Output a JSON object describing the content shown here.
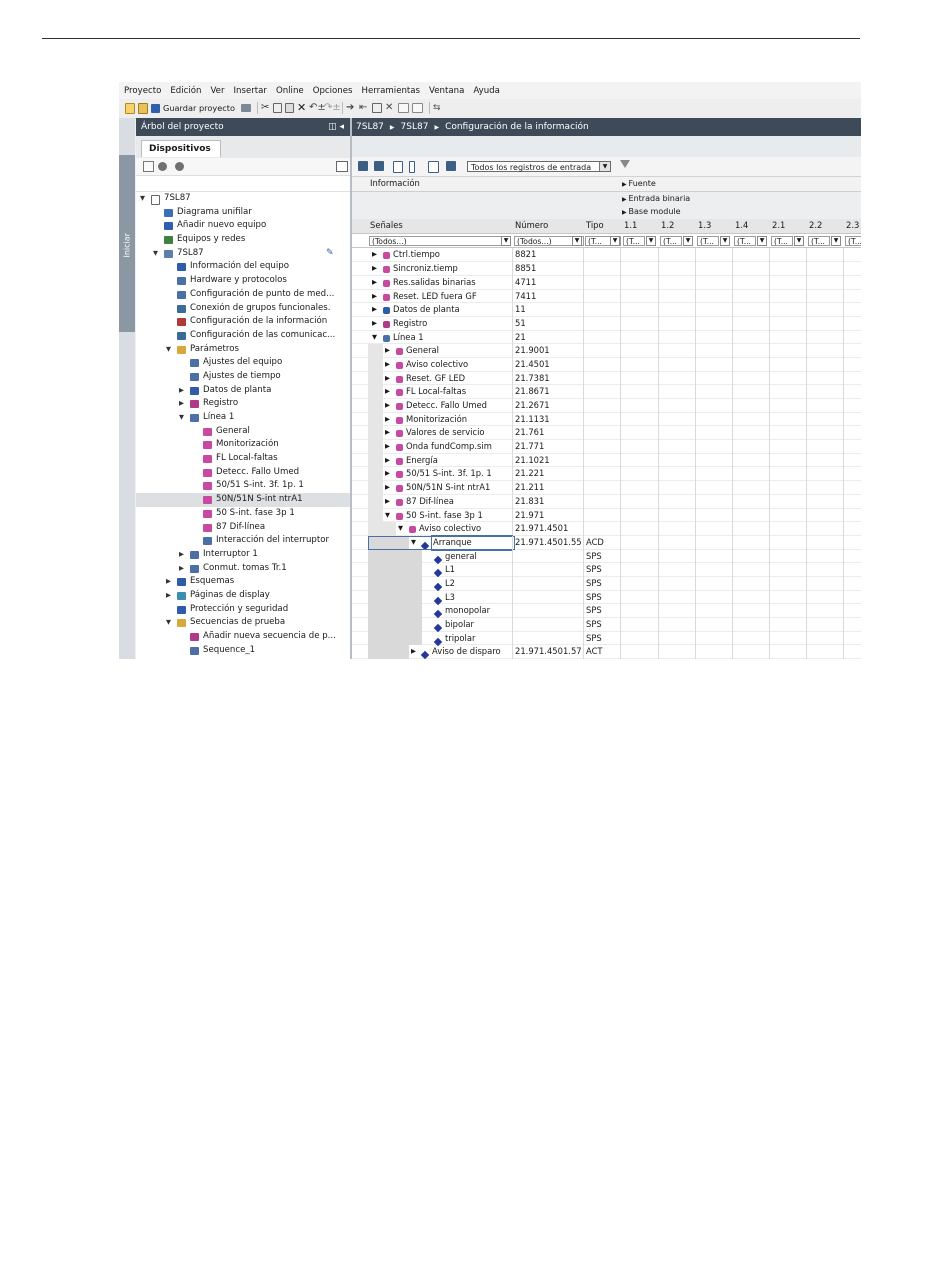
{
  "menu": [
    "Proyecto",
    "Edición",
    "Ver",
    "Insertar",
    "Online",
    "Opciones",
    "Herramientas",
    "Ventana",
    "Ayuda"
  ],
  "toolbar": {
    "save_label": "Guardar proyecto"
  },
  "side_tab": "Iniciar",
  "project_tree": {
    "title": "Árbol del proyecto",
    "tab": "Dispositivos",
    "items": [
      {
        "label": "7SL87",
        "level": 0,
        "expand": "open",
        "icon": "device-icon",
        "color": "#ffffff"
      },
      {
        "label": "Diagrama unifilar",
        "level": 1,
        "expand": "",
        "icon": "single-line-icon",
        "color": "#3b6fb6"
      },
      {
        "label": "Añadir nuevo equipo",
        "level": 1,
        "expand": "",
        "icon": "add-device-icon",
        "color": "#2f5fb0"
      },
      {
        "label": "Equipos y redes",
        "level": 1,
        "expand": "",
        "icon": "network-icon",
        "color": "#3f7f3f"
      },
      {
        "label": "7SL87",
        "level": 1,
        "expand": "open",
        "icon": "device-icon",
        "color": "#5a7fa8"
      },
      {
        "label": "Información del equipo",
        "level": 2,
        "expand": "",
        "icon": "info-icon",
        "color": "#2e5ca8"
      },
      {
        "label": "Hardware y protocolos",
        "level": 2,
        "expand": "",
        "icon": "hardware-icon",
        "color": "#4b6fa6"
      },
      {
        "label": "Configuración de punto de med...",
        "level": 2,
        "expand": "",
        "icon": "config-icon",
        "color": "#4b6fa6"
      },
      {
        "label": "Conexión de grupos funcionales.",
        "level": 2,
        "expand": "",
        "icon": "connect-icon",
        "color": "#3a6c98"
      },
      {
        "label": "Configuración de la información",
        "level": 2,
        "expand": "",
        "icon": "matrix-icon",
        "color": "#b03a3a"
      },
      {
        "label": "Configuración de las comunicac...",
        "level": 2,
        "expand": "",
        "icon": "comm-icon",
        "color": "#3a6c98"
      },
      {
        "label": "Parámetros",
        "level": 2,
        "expand": "open",
        "icon": "params-icon",
        "color": "#d7a93c"
      },
      {
        "label": "Ajustes del equipo",
        "level": 3,
        "expand": "",
        "icon": "settings-icon",
        "color": "#4b6fa6"
      },
      {
        "label": "Ajustes de tiempo",
        "level": 3,
        "expand": "",
        "icon": "clock-icon",
        "color": "#4b6fa6"
      },
      {
        "label": "Datos de planta",
        "level": 3,
        "expand": "closed",
        "icon": "plant-icon",
        "color": "#2e5ca8"
      },
      {
        "label": "Registro",
        "level": 3,
        "expand": "closed",
        "icon": "recorder-icon",
        "color": "#b03a8a"
      },
      {
        "label": "Línea 1",
        "level": 3,
        "expand": "open",
        "icon": "line-icon",
        "color": "#4b6fa6"
      },
      {
        "label": "General",
        "level": 4,
        "expand": "",
        "icon": "function-block-icon",
        "color": "#c84aa0"
      },
      {
        "label": "Monitorización",
        "level": 4,
        "expand": "",
        "icon": "function-block-icon",
        "color": "#c84aa0"
      },
      {
        "label": "FL Local-faltas",
        "level": 4,
        "expand": "",
        "icon": "function-block-icon",
        "color": "#c84aa0"
      },
      {
        "label": "Detecc. Fallo Umed",
        "level": 4,
        "expand": "",
        "icon": "function-block-icon",
        "color": "#c84aa0"
      },
      {
        "label": "50/51 S-int. 3f. 1p. 1",
        "level": 4,
        "expand": "",
        "icon": "function-block-icon",
        "color": "#c84aa0"
      },
      {
        "label": "50N/51N S-int ntrA1",
        "level": 4,
        "expand": "",
        "icon": "function-block-icon",
        "color": "#c84aa0",
        "selected": true
      },
      {
        "label": "50 S-int. fase 3p 1",
        "level": 4,
        "expand": "",
        "icon": "function-block-icon",
        "color": "#c84aa0"
      },
      {
        "label": "87 Dif-línea",
        "level": 4,
        "expand": "",
        "icon": "function-block-icon",
        "color": "#c84aa0"
      },
      {
        "label": "Interacción del interruptor",
        "level": 4,
        "expand": "",
        "icon": "interaction-icon",
        "color": "#4b6fa6"
      },
      {
        "label": "Interruptor 1",
        "level": 3,
        "expand": "closed",
        "icon": "breaker-icon",
        "color": "#4b6fa6"
      },
      {
        "label": "Conmut. tomas Tr.1",
        "level": 3,
        "expand": "closed",
        "icon": "tapchanger-icon",
        "color": "#4b6fa6"
      },
      {
        "label": "Esquemas",
        "level": 2,
        "expand": "closed",
        "icon": "chart-icon",
        "color": "#2e5ca8"
      },
      {
        "label": "Páginas de display",
        "level": 2,
        "expand": "closed",
        "icon": "display-icon",
        "color": "#3a8fb0"
      },
      {
        "label": "Protección y seguridad",
        "level": 2,
        "expand": "",
        "icon": "security-icon",
        "color": "#2e5ca8"
      },
      {
        "label": "Secuencias de prueba",
        "level": 2,
        "expand": "open",
        "icon": "test-seq-icon",
        "color": "#d7a93c"
      },
      {
        "label": "Añadir nueva secuencia de p...",
        "level": 3,
        "expand": "",
        "icon": "add-seq-icon",
        "color": "#b03a8a"
      },
      {
        "label": "Sequence_1",
        "level": 3,
        "expand": "",
        "icon": "sequence-icon",
        "color": "#4b6fa6"
      }
    ]
  },
  "editor": {
    "breadcrumb": [
      "7SL87",
      "7SL87",
      "Configuración de la información"
    ],
    "filter_select": "Todos los registros de entrada",
    "info_header": "Información",
    "source_header": "Fuente",
    "binary_input_header": "Entrada binaria",
    "base_module_header": "Base module",
    "columns": {
      "signals": "Señales",
      "number": "Número",
      "type": "Tipo"
    },
    "module_columns": [
      "1.1",
      "1.2",
      "1.3",
      "1.4",
      "2.1",
      "2.2",
      "2.3"
    ],
    "filters": {
      "signals": "(Todos...)",
      "number": "(Todos...)",
      "type": "(T...",
      "module": "(T..."
    },
    "rows": [
      {
        "label": "Ctrl.tiempo",
        "number": "8821",
        "type": "",
        "level": 0,
        "expand": "closed",
        "icon": "function-block-icon",
        "marks": {}
      },
      {
        "label": "Sincroniz.tiemp",
        "number": "8851",
        "type": "",
        "level": 0,
        "expand": "closed",
        "icon": "function-block-icon",
        "marks": {}
      },
      {
        "label": "Res.salidas binarias",
        "number": "4711",
        "type": "",
        "level": 0,
        "expand": "closed",
        "icon": "function-block-icon",
        "marks": {}
      },
      {
        "label": "Reset. LED fuera GF",
        "number": "7411",
        "type": "",
        "level": 0,
        "expand": "closed",
        "icon": "function-block-icon",
        "marks": {}
      },
      {
        "label": "Datos de planta",
        "number": "11",
        "type": "",
        "level": 0,
        "expand": "closed",
        "icon": "plant-icon",
        "marks": {
          "2.2": "*"
        }
      },
      {
        "label": "Registro",
        "number": "51",
        "type": "",
        "level": 0,
        "expand": "closed",
        "icon": "recorder-icon",
        "marks": {}
      },
      {
        "label": "Línea 1",
        "number": "21",
        "type": "",
        "level": 0,
        "expand": "open",
        "icon": "line-icon",
        "marks": {}
      },
      {
        "label": "General",
        "number": "21.9001",
        "type": "",
        "level": 1,
        "expand": "closed",
        "icon": "function-block-icon",
        "marks": {}
      },
      {
        "label": "Aviso colectivo",
        "number": "21.4501",
        "type": "",
        "level": 1,
        "expand": "closed",
        "icon": "function-block-icon",
        "marks": {}
      },
      {
        "label": "Reset. GF LED",
        "number": "21.7381",
        "type": "",
        "level": 1,
        "expand": "closed",
        "icon": "function-block-icon",
        "marks": {}
      },
      {
        "label": "FL Local-faltas",
        "number": "21.8671",
        "type": "",
        "level": 1,
        "expand": "closed",
        "icon": "function-block-icon",
        "marks": {}
      },
      {
        "label": "Detecc. Fallo Umed",
        "number": "21.2671",
        "type": "",
        "level": 1,
        "expand": "closed",
        "icon": "function-block-icon",
        "marks": {}
      },
      {
        "label": "Monitorización",
        "number": "21.1131",
        "type": "",
        "level": 1,
        "expand": "closed",
        "icon": "function-block-icon",
        "marks": {}
      },
      {
        "label": "Valores de servicio",
        "number": "21.761",
        "type": "",
        "level": 1,
        "expand": "closed",
        "icon": "function-block-icon",
        "marks": {}
      },
      {
        "label": "Onda fundComp.sim",
        "number": "21.771",
        "type": "",
        "level": 1,
        "expand": "closed",
        "icon": "function-block-icon",
        "marks": {}
      },
      {
        "label": "Energía",
        "number": "21.1021",
        "type": "",
        "level": 1,
        "expand": "closed",
        "icon": "function-block-icon",
        "marks": {}
      },
      {
        "label": "50/51 S-int. 3f. 1p. 1",
        "number": "21.221",
        "type": "",
        "level": 1,
        "expand": "closed",
        "icon": "function-block-icon",
        "marks": {}
      },
      {
        "label": "50N/51N S-int ntrA1",
        "number": "21.211",
        "type": "",
        "level": 1,
        "expand": "closed",
        "icon": "function-block-icon",
        "marks": {}
      },
      {
        "label": "87 Dif-línea",
        "number": "21.831",
        "type": "",
        "level": 1,
        "expand": "closed",
        "icon": "function-block-icon",
        "marks": {}
      },
      {
        "label": "50 S-int. fase 3p 1",
        "number": "21.971",
        "type": "",
        "level": 1,
        "expand": "open",
        "icon": "function-block-icon",
        "marks": {}
      },
      {
        "label": "Aviso colectivo",
        "number": "21.971.4501",
        "type": "",
        "level": 2,
        "expand": "open",
        "icon": "function-block-icon",
        "marks": {}
      },
      {
        "label": "Arranque",
        "number": "21.971.4501.55",
        "type": "ACD",
        "level": 3,
        "expand": "open",
        "icon": "signal-icon",
        "marks": {},
        "selected": true
      },
      {
        "label": "general",
        "number": "",
        "type": "SPS",
        "level": 4,
        "expand": "",
        "icon": "signal-icon",
        "marks": {}
      },
      {
        "label": "L1",
        "number": "",
        "type": "SPS",
        "level": 4,
        "expand": "",
        "icon": "signal-icon",
        "marks": {}
      },
      {
        "label": "L2",
        "number": "",
        "type": "SPS",
        "level": 4,
        "expand": "",
        "icon": "signal-icon",
        "marks": {}
      },
      {
        "label": "L3",
        "number": "",
        "type": "SPS",
        "level": 4,
        "expand": "",
        "icon": "signal-icon",
        "marks": {}
      },
      {
        "label": "monopolar",
        "number": "",
        "type": "SPS",
        "level": 4,
        "expand": "",
        "icon": "signal-icon",
        "marks": {}
      },
      {
        "label": "bipolar",
        "number": "",
        "type": "SPS",
        "level": 4,
        "expand": "",
        "icon": "signal-icon",
        "marks": {}
      },
      {
        "label": "tripolar",
        "number": "",
        "type": "SPS",
        "level": 4,
        "expand": "",
        "icon": "signal-icon",
        "marks": {}
      },
      {
        "label": "Aviso de disparo",
        "number": "21.971.4501.57",
        "type": "ACT",
        "level": 3,
        "expand": "closed",
        "icon": "signal-icon",
        "marks": {}
      }
    ]
  },
  "colors": {
    "header_bar": "#3e4a58",
    "function_block": "#c84aa0",
    "signal": "#24379a",
    "side_tab": "#8b97a3"
  }
}
